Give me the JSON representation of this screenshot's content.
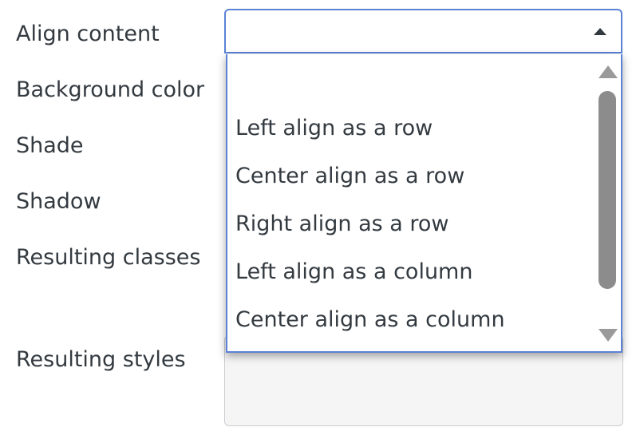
{
  "labels": {
    "align_content": "Align content",
    "background_color": "Background color",
    "shade": "Shade",
    "shadow": "Shadow",
    "resulting_classes": "Resulting classes",
    "resulting_styles": "Resulting styles"
  },
  "align_select": {
    "value": "",
    "options": [
      "",
      "Left align as a row",
      "Center align as a row",
      "Right align as a row",
      "Left align as a column",
      "Center align as a column"
    ]
  },
  "colors": {
    "focus_border": "#5b82d6",
    "text": "#333a40",
    "scrollbar": "#8c8c8c",
    "readonly_bg": "#f5f5f5"
  }
}
